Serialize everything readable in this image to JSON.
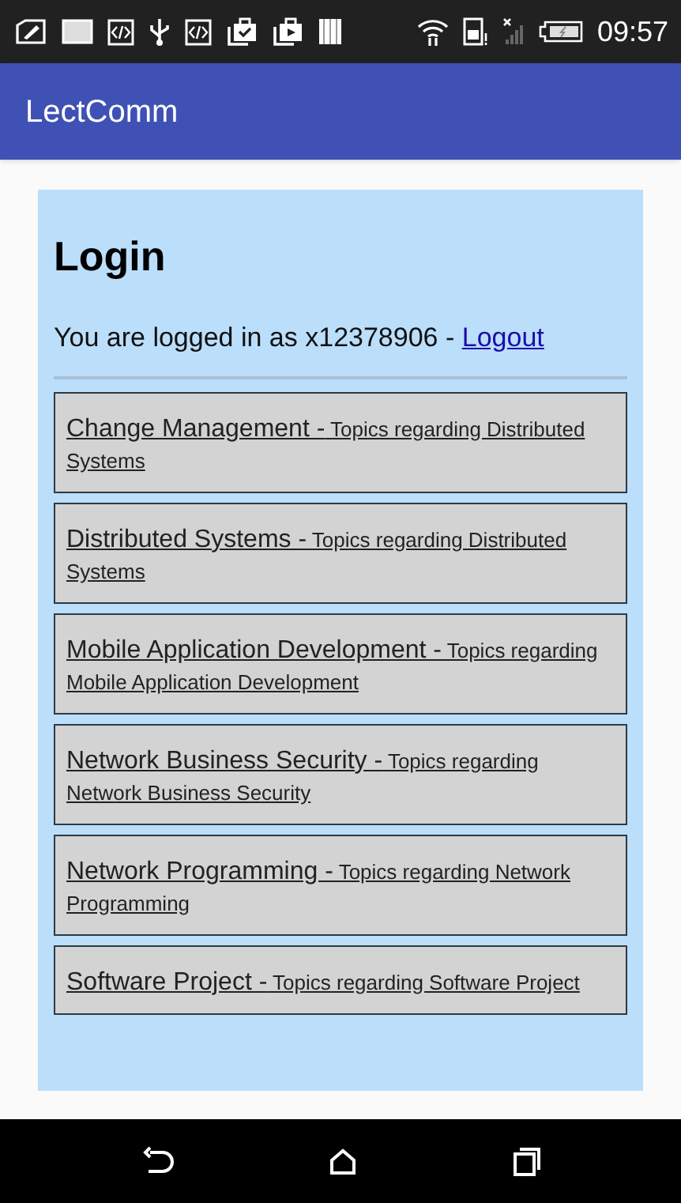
{
  "status_bar": {
    "time": "09:57"
  },
  "app_bar": {
    "title": "LectComm"
  },
  "login": {
    "heading": "Login",
    "message": "You are logged in as x12378906 -",
    "logout_link": "Logout"
  },
  "courses": [
    {
      "title": "Change Management -",
      "description": "Topics regarding Distributed Systems"
    },
    {
      "title": "Distributed Systems -",
      "description": "Topics regarding Distributed Systems"
    },
    {
      "title": "Mobile Application Development -",
      "description": "Topics regarding Mobile Application Development"
    },
    {
      "title": "Network Business Security -",
      "description": "Topics regarding Network Business Security"
    },
    {
      "title": "Network Programming -",
      "description": "Topics regarding Network Programming"
    },
    {
      "title": "Software Project -",
      "description": "Topics regarding Software Project"
    }
  ]
}
